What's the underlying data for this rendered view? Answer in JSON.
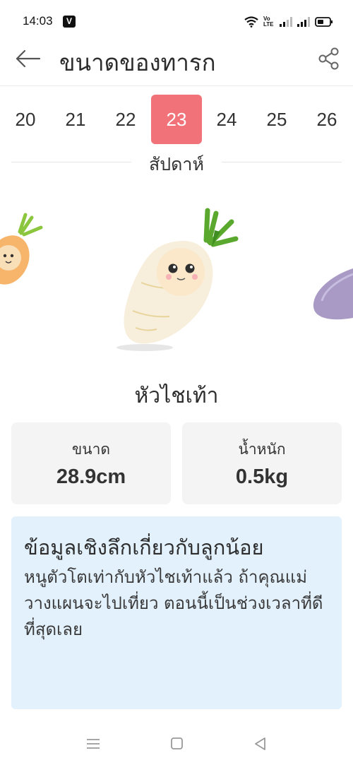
{
  "status_bar": {
    "time": "14:03",
    "app_badge": "V",
    "volte_top": "Vo",
    "volte_bottom": "LTE"
  },
  "app_bar": {
    "title": "ขนาดของทารก",
    "back_icon": "arrow-left-icon",
    "share_icon": "share-icon"
  },
  "weeks": {
    "items": [
      "20",
      "21",
      "22",
      "23",
      "24",
      "25",
      "26"
    ],
    "selected": "23",
    "caption": "สัปดาห์",
    "selected_color": "#f2727a"
  },
  "fruit": {
    "name": "หัวไชเท้า"
  },
  "stats": {
    "size_label": "ขนาด",
    "size_value": "28.9cm",
    "weight_label": "น้ำหนัก",
    "weight_value": "0.5kg"
  },
  "insight": {
    "title": "ข้อมูลเชิงลึกเกี่ยวกับลูกน้อย",
    "body": "หนูตัวโตเท่ากับหัวไชเท้าแล้ว ถ้าคุณแม่วางแผนจะไปเที่ยว ตอนนี้เป็นช่วงเวลาที่ดีที่สุดเลย",
    "background": "#e3f1fd"
  },
  "nav_bar": {
    "icons": [
      "menu-icon",
      "home-square-icon",
      "back-triangle-icon"
    ]
  }
}
